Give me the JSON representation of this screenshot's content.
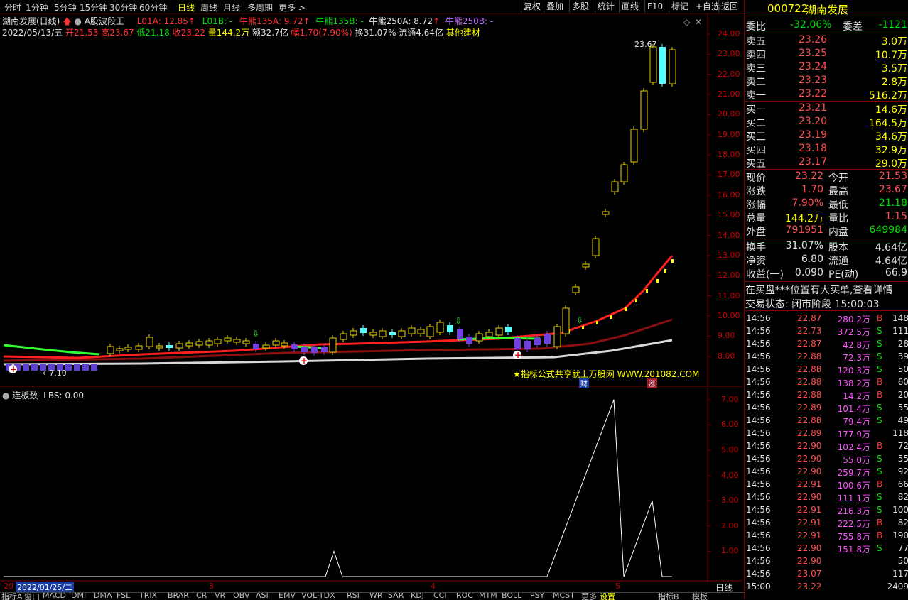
{
  "toolbar": {
    "periods": [
      "分时",
      "1分钟",
      "5分钟",
      "15分钟",
      "30分钟",
      "60分钟",
      "日线",
      "周线",
      "月线",
      "多周期",
      "更多 >"
    ],
    "active_period": "日线",
    "right_buttons": [
      "复权",
      "叠加",
      "多股",
      "统计",
      "画线",
      "F10",
      "标记",
      "+自选",
      "返回"
    ]
  },
  "header": {
    "stock_title": "湖南发展(日线)",
    "indicator_name": "A股波段王",
    "l01a": "L01A: 12.85",
    "l01b": "L01B: -",
    "nx135a": "牛熊135A: 9.72",
    "nx135b": "牛熊135B: -",
    "nx250a": "牛熊250A: 8.72",
    "nx250b": "牛熊250B: -"
  },
  "ohlc_line": {
    "date": "2022/05/13/五",
    "open": "开21.53",
    "high": "高23.67",
    "low": "低21.18",
    "close": "收23.22",
    "vol": "量144.2万",
    "amount": "额32.7亿",
    "change": "幅1.70(7.90%)",
    "turnover": "换31.07%",
    "float_cap": "流通4.64亿",
    "sector": "其他建材"
  },
  "price_axis": [
    "24.00",
    "23.00",
    "22.00",
    "21.00",
    "20.00",
    "19.00",
    "18.00",
    "17.00",
    "16.00",
    "15.00",
    "14.00",
    "13.00",
    "12.00",
    "11.00",
    "10.00",
    "9.00",
    "8.00"
  ],
  "annotations": {
    "max_label": "23.67",
    "min_label": "←7.10",
    "watermark": "★指标公式共享就上万股网 WWW.201082.COM",
    "badge_cai": "财",
    "badge_zhang": "涨"
  },
  "sub_header": {
    "name": "连板数",
    "value": "LBS: 0.00"
  },
  "sub_axis": [
    "7.00",
    "6.00",
    "5.00",
    "4.00",
    "3.00",
    "2.00",
    "1.00"
  ],
  "date_axis": {
    "cursor_date": "2022/01/25/二",
    "months": [
      "3",
      "4",
      "5"
    ],
    "prefix": "20"
  },
  "bottom_indicators": [
    "指标A",
    "窗口",
    "MACD",
    "DMI",
    "DMA",
    "FSL",
    "TRIX",
    "BRAR",
    "CR",
    "VR",
    "OBV",
    "ASI",
    "EMV",
    "VOL-TDX",
    "RSI",
    "WR",
    "SAR",
    "KDJ",
    "CCI",
    "ROC",
    "MTM",
    "BOLL",
    "PSY",
    "MCST",
    "更多",
    "设置"
  ],
  "bottom_right": [
    "指标B",
    "模板",
    "日线"
  ],
  "panel": {
    "code": "000722",
    "name": "湖南发展",
    "webi_label": "委比",
    "webi_value": "-32.06%",
    "wecha_label": "委差",
    "wecha_value": "-1121",
    "sells": [
      {
        "label": "卖五",
        "price": "23.26",
        "vol": "3.0万"
      },
      {
        "label": "卖四",
        "price": "23.25",
        "vol": "10.7万"
      },
      {
        "label": "卖三",
        "price": "23.24",
        "vol": "3.5万"
      },
      {
        "label": "卖二",
        "price": "23.23",
        "vol": "2.8万"
      },
      {
        "label": "卖一",
        "price": "23.22",
        "vol": "516.2万"
      }
    ],
    "buys": [
      {
        "label": "买一",
        "price": "23.21",
        "vol": "14.6万"
      },
      {
        "label": "买二",
        "price": "23.20",
        "vol": "164.5万"
      },
      {
        "label": "买三",
        "price": "23.19",
        "vol": "34.6万"
      },
      {
        "label": "买四",
        "price": "23.18",
        "vol": "32.9万"
      },
      {
        "label": "买五",
        "price": "23.17",
        "vol": "29.0万"
      }
    ],
    "stats": [
      {
        "l1": "现价",
        "v1": "23.22",
        "l2": "今开",
        "v2": "21.53"
      },
      {
        "l1": "涨跌",
        "v1": "1.70",
        "l2": "最高",
        "v2": "23.67"
      },
      {
        "l1": "涨幅",
        "v1": "7.90%",
        "l2": "最低",
        "v2": "21.18"
      },
      {
        "l1": "总量",
        "v1": "144.2万",
        "l2": "量比",
        "v2": "1.15"
      },
      {
        "l1": "外盘",
        "v1": "791951",
        "l2": "内盘",
        "v2": "649984"
      }
    ],
    "stats2": [
      {
        "l1": "换手",
        "v1": "31.07%",
        "l2": "股本",
        "v2": "4.64亿"
      },
      {
        "l1": "净资",
        "v1": "6.80",
        "l2": "流通",
        "v2": "4.64亿"
      },
      {
        "l1": "收益(一)",
        "v1": "0.090",
        "l2": "PE(动)",
        "v2": "66.9"
      }
    ],
    "notice": "在买盘***位置有大买单,查看详情",
    "trade_status": "交易状态: 闭市阶段 15:00:03",
    "ticks": [
      {
        "t": "14:56",
        "p": "22.87",
        "v": "280.2万",
        "s": "B",
        "n": "148"
      },
      {
        "t": "14:56",
        "p": "22.73",
        "v": "372.5万",
        "s": "S",
        "n": "111"
      },
      {
        "t": "14:56",
        "p": "22.87",
        "v": "42.8万",
        "s": "S",
        "n": "28"
      },
      {
        "t": "14:56",
        "p": "22.88",
        "v": "72.3万",
        "s": "S",
        "n": "39"
      },
      {
        "t": "14:56",
        "p": "22.88",
        "v": "120.3万",
        "s": "S",
        "n": "50"
      },
      {
        "t": "14:56",
        "p": "22.88",
        "v": "138.2万",
        "s": "B",
        "n": "60"
      },
      {
        "t": "14:56",
        "p": "22.88",
        "v": "14.2万",
        "s": "B",
        "n": "20"
      },
      {
        "t": "14:56",
        "p": "22.89",
        "v": "101.4万",
        "s": "S",
        "n": "55"
      },
      {
        "t": "14:56",
        "p": "22.88",
        "v": "79.4万",
        "s": "S",
        "n": "49"
      },
      {
        "t": "14:56",
        "p": "22.89",
        "v": "177.9万",
        "s": "",
        "n": "118"
      },
      {
        "t": "14:56",
        "p": "22.90",
        "v": "102.4万",
        "s": "B",
        "n": "72"
      },
      {
        "t": "14:56",
        "p": "22.90",
        "v": "55.0万",
        "s": "S",
        "n": "55"
      },
      {
        "t": "14:56",
        "p": "22.90",
        "v": "259.7万",
        "s": "S",
        "n": "92"
      },
      {
        "t": "14:56",
        "p": "22.91",
        "v": "100.6万",
        "s": "B",
        "n": "66"
      },
      {
        "t": "14:56",
        "p": "22.90",
        "v": "111.1万",
        "s": "S",
        "n": "82"
      },
      {
        "t": "14:56",
        "p": "22.91",
        "v": "216.3万",
        "s": "S",
        "n": "100"
      },
      {
        "t": "14:56",
        "p": "22.91",
        "v": "222.5万",
        "s": "B",
        "n": "82"
      },
      {
        "t": "14:56",
        "p": "22.91",
        "v": "755.8万",
        "s": "B",
        "n": "190"
      },
      {
        "t": "14:56",
        "p": "22.90",
        "v": "151.8万",
        "s": "S",
        "n": "77"
      },
      {
        "t": "14:56",
        "p": "22.90",
        "v": "",
        "s": "",
        "n": "50"
      },
      {
        "t": "14:56",
        "p": "23.07",
        "v": "",
        "s": "",
        "n": "117"
      },
      {
        "t": "15:00",
        "p": "23.22",
        "v": "",
        "s": "",
        "n": "2409"
      }
    ]
  },
  "colors": {
    "red": "#ff3232",
    "green": "#00e000",
    "yellow": "#ffff00",
    "cyan": "#54ffff",
    "magenta": "#ff54ff",
    "dark_red": "#7a0000",
    "price_red": "#ff5050"
  }
}
